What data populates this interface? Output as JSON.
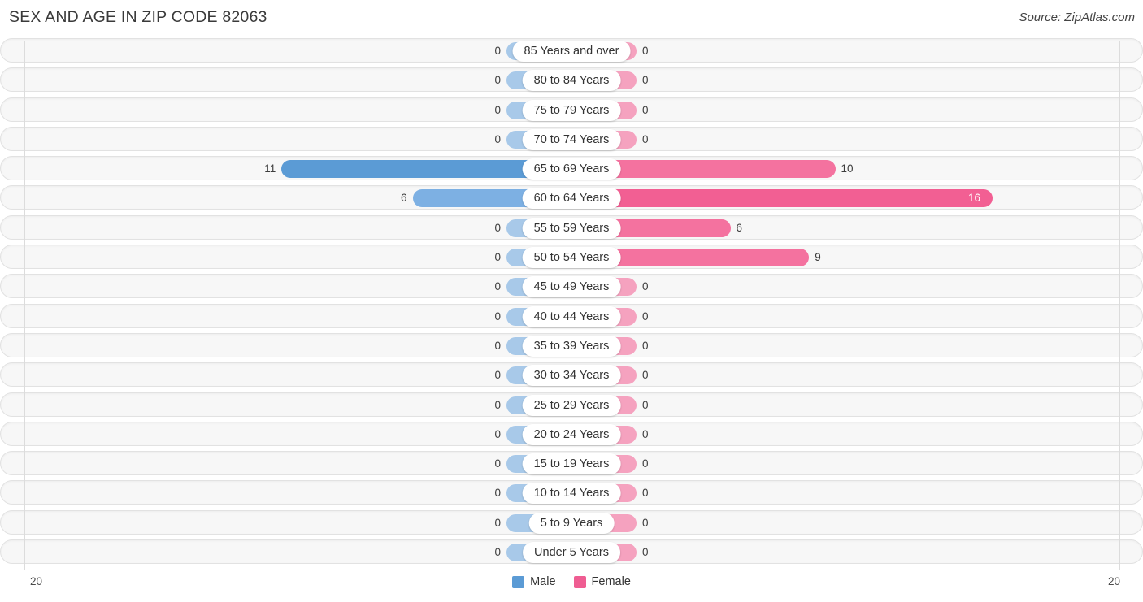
{
  "header": {
    "title": "SEX AND AGE IN ZIP CODE 82063",
    "source": "Source: ZipAtlas.com"
  },
  "legend": {
    "male_label": "Male",
    "female_label": "Female",
    "male_color": "#5b9bd5",
    "female_color": "#ef5d92"
  },
  "axis": {
    "left_tick": "20",
    "right_tick": "20"
  },
  "chart_data": {
    "type": "bar",
    "title": "SEX AND AGE IN ZIP CODE 82063",
    "subtitle": "Source: ZipAtlas.com",
    "orientation": "horizontal-diverging",
    "xlabel": "",
    "ylabel": "",
    "xlim": [
      20,
      20
    ],
    "grid": false,
    "legend_position": "bottom-center",
    "categories": [
      "85 Years and over",
      "80 to 84 Years",
      "75 to 79 Years",
      "70 to 74 Years",
      "65 to 69 Years",
      "60 to 64 Years",
      "55 to 59 Years",
      "50 to 54 Years",
      "45 to 49 Years",
      "40 to 44 Years",
      "35 to 39 Years",
      "30 to 34 Years",
      "25 to 29 Years",
      "20 to 24 Years",
      "15 to 19 Years",
      "10 to 14 Years",
      "5 to 9 Years",
      "Under 5 Years"
    ],
    "series": [
      {
        "name": "Male",
        "color": "#5b9bd5",
        "values": [
          0,
          0,
          0,
          0,
          11,
          6,
          0,
          0,
          0,
          0,
          0,
          0,
          0,
          0,
          0,
          0,
          0,
          0
        ]
      },
      {
        "name": "Female",
        "color": "#ef5d92",
        "values": [
          0,
          0,
          0,
          0,
          10,
          16,
          6,
          9,
          0,
          0,
          0,
          0,
          0,
          0,
          0,
          0,
          0,
          0
        ]
      }
    ]
  },
  "rows": [
    {
      "category": "85 Years and over",
      "male": "0",
      "female": "0",
      "male_w": 0,
      "female_w": 0
    },
    {
      "category": "80 to 84 Years",
      "male": "0",
      "female": "0",
      "male_w": 0,
      "female_w": 0
    },
    {
      "category": "75 to 79 Years",
      "male": "0",
      "female": "0",
      "male_w": 0,
      "female_w": 0
    },
    {
      "category": "70 to 74 Years",
      "male": "0",
      "female": "0",
      "male_w": 0,
      "female_w": 0
    },
    {
      "category": "65 to 69 Years",
      "male": "11",
      "female": "10",
      "male_w": 11,
      "female_w": 10
    },
    {
      "category": "60 to 64 Years",
      "male": "6",
      "female": "16",
      "male_w": 6,
      "female_w": 16
    },
    {
      "category": "55 to 59 Years",
      "male": "0",
      "female": "6",
      "male_w": 0,
      "female_w": 6
    },
    {
      "category": "50 to 54 Years",
      "male": "0",
      "female": "9",
      "male_w": 0,
      "female_w": 9
    },
    {
      "category": "45 to 49 Years",
      "male": "0",
      "female": "0",
      "male_w": 0,
      "female_w": 0
    },
    {
      "category": "40 to 44 Years",
      "male": "0",
      "female": "0",
      "male_w": 0,
      "female_w": 0
    },
    {
      "category": "35 to 39 Years",
      "male": "0",
      "female": "0",
      "male_w": 0,
      "female_w": 0
    },
    {
      "category": "30 to 34 Years",
      "male": "0",
      "female": "0",
      "male_w": 0,
      "female_w": 0
    },
    {
      "category": "25 to 29 Years",
      "male": "0",
      "female": "0",
      "male_w": 0,
      "female_w": 0
    },
    {
      "category": "20 to 24 Years",
      "male": "0",
      "female": "0",
      "male_w": 0,
      "female_w": 0
    },
    {
      "category": "15 to 19 Years",
      "male": "0",
      "female": "0",
      "male_w": 0,
      "female_w": 0
    },
    {
      "category": "10 to 14 Years",
      "male": "0",
      "female": "0",
      "male_w": 0,
      "female_w": 0
    },
    {
      "category": "5 to 9 Years",
      "male": "0",
      "female": "0",
      "male_w": 0,
      "female_w": 0
    },
    {
      "category": "Under 5 Years",
      "male": "0",
      "female": "0",
      "male_w": 0,
      "female_w": 0
    }
  ]
}
